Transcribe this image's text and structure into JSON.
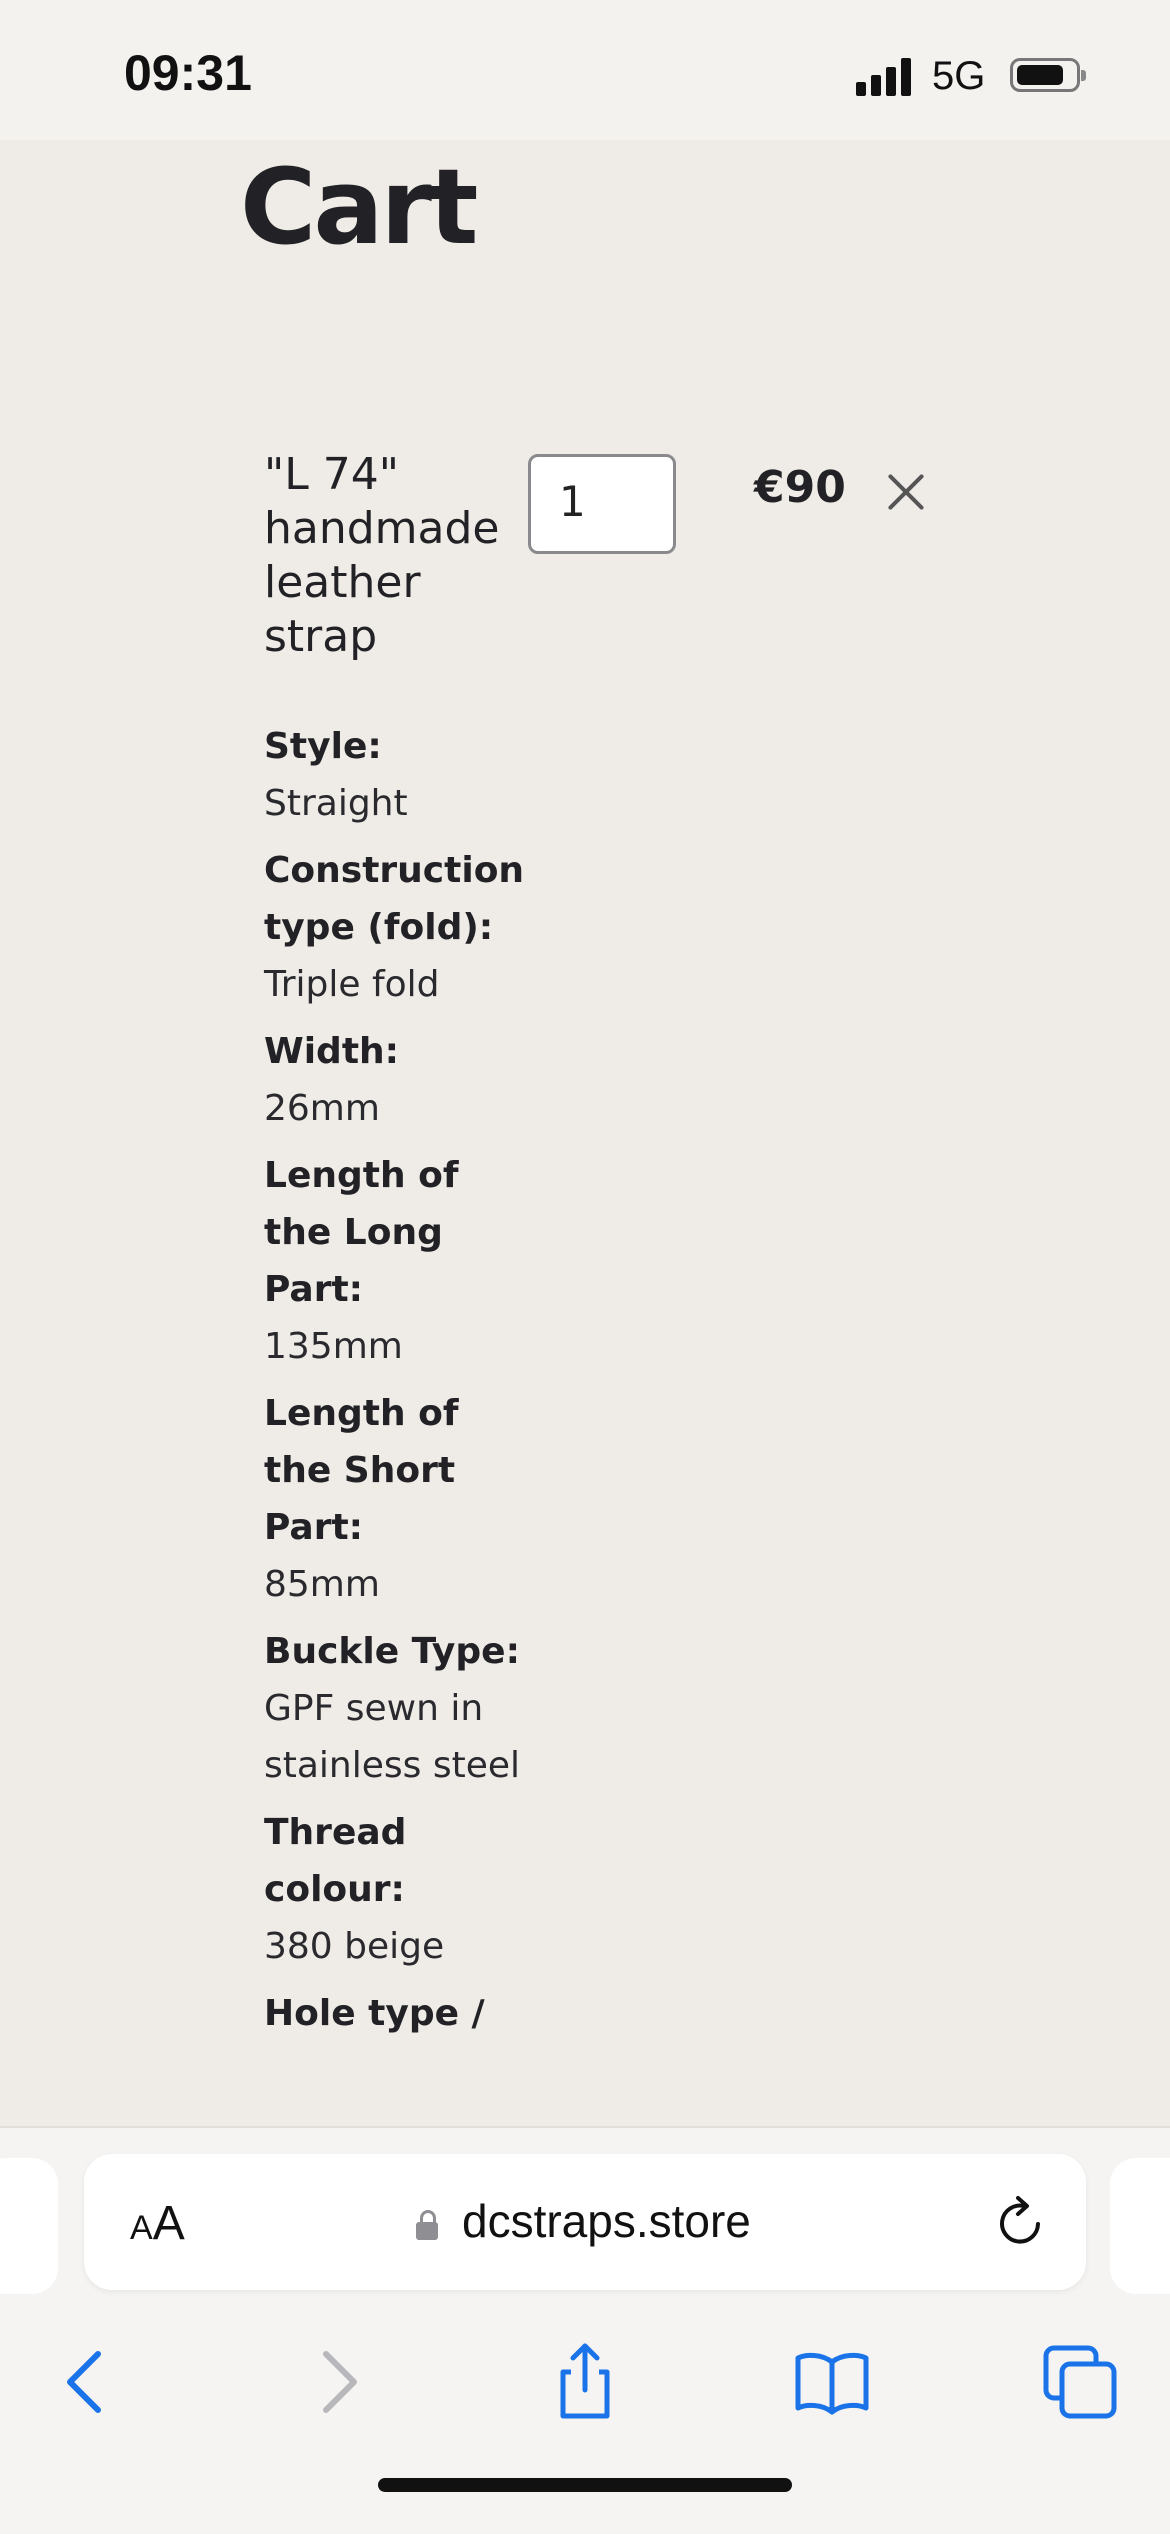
{
  "status": {
    "time": "09:31",
    "network": "5G"
  },
  "page": {
    "title": "Cart"
  },
  "cart": {
    "item": {
      "name": "\"L 74\" handmade leather strap",
      "quantity": "1",
      "price": "€90"
    },
    "options": [
      {
        "label": "Style:",
        "value": "Straight"
      },
      {
        "label": "Construction type (fold):",
        "value": "Triple fold"
      },
      {
        "label": "Width:",
        "value": "26mm"
      },
      {
        "label": "Length of the Long Part:",
        "value": "135mm"
      },
      {
        "label": "Length of the Short Part:",
        "value": "85mm"
      },
      {
        "label": "Buckle Type:",
        "value": "GPF sewn in stainless steel"
      },
      {
        "label": "Thread colour:",
        "value": "380 beige"
      },
      {
        "label": "Hole type /",
        "value": ""
      }
    ]
  },
  "browser": {
    "text_size_label_small": "A",
    "text_size_label_large": "A",
    "url": "dcstraps.store"
  },
  "colors": {
    "accent": "#1a73e8",
    "disabled": "#b8b8bc",
    "background": "#efebe6"
  },
  "icons": [
    "lock-icon",
    "reload-icon",
    "back-icon",
    "forward-icon",
    "share-icon",
    "bookmarks-icon",
    "tabs-icon",
    "remove-icon"
  ]
}
